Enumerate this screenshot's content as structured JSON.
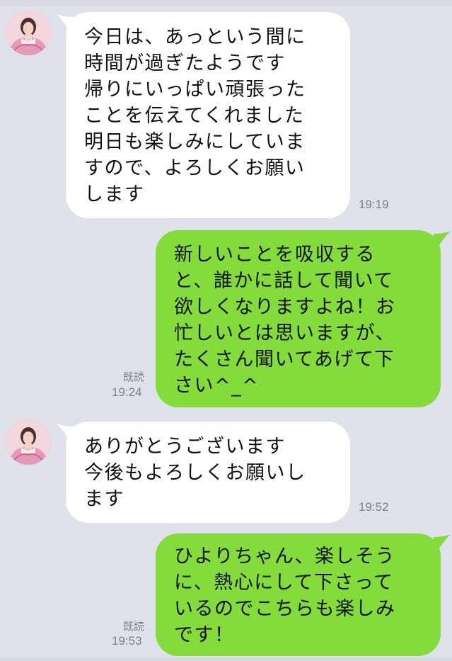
{
  "chat": {
    "messages": [
      {
        "direction": "in",
        "avatar": "contact-avatar",
        "lines": [
          "今日は、あっという間に",
          "時間が過ぎたようです",
          "帰りにいっぱい頑張った",
          "ことを伝えてくれました",
          "明日も楽しみにしていま",
          "すので、よろしくお願い",
          "します"
        ],
        "time": "19:19"
      },
      {
        "direction": "out",
        "read": "既読",
        "lines": [
          "新しいことを吸収する",
          "と、誰かに話して聞いて",
          "欲しくなりますよね！お",
          "忙しいとは思いますが、",
          "たくさん聞いてあげて下",
          "さい^_^"
        ],
        "time": "19:24"
      },
      {
        "direction": "in",
        "avatar": "contact-avatar",
        "lines": [
          "ありがとうございます",
          "今後もよろしくお願いし",
          "ます"
        ],
        "time": "19:52"
      },
      {
        "direction": "out",
        "read": "既読",
        "lines": [
          "ひよりちゃん、楽しそう",
          "に、熱心にして下さって",
          "いるのでこちらも楽しみ",
          "です！"
        ],
        "time": "19:53"
      }
    ]
  },
  "colors": {
    "background": "#dfe2ea",
    "incoming_bubble": "#ffffff",
    "outgoing_bubble": "#84dc3a",
    "meta_text": "#7d8089"
  }
}
